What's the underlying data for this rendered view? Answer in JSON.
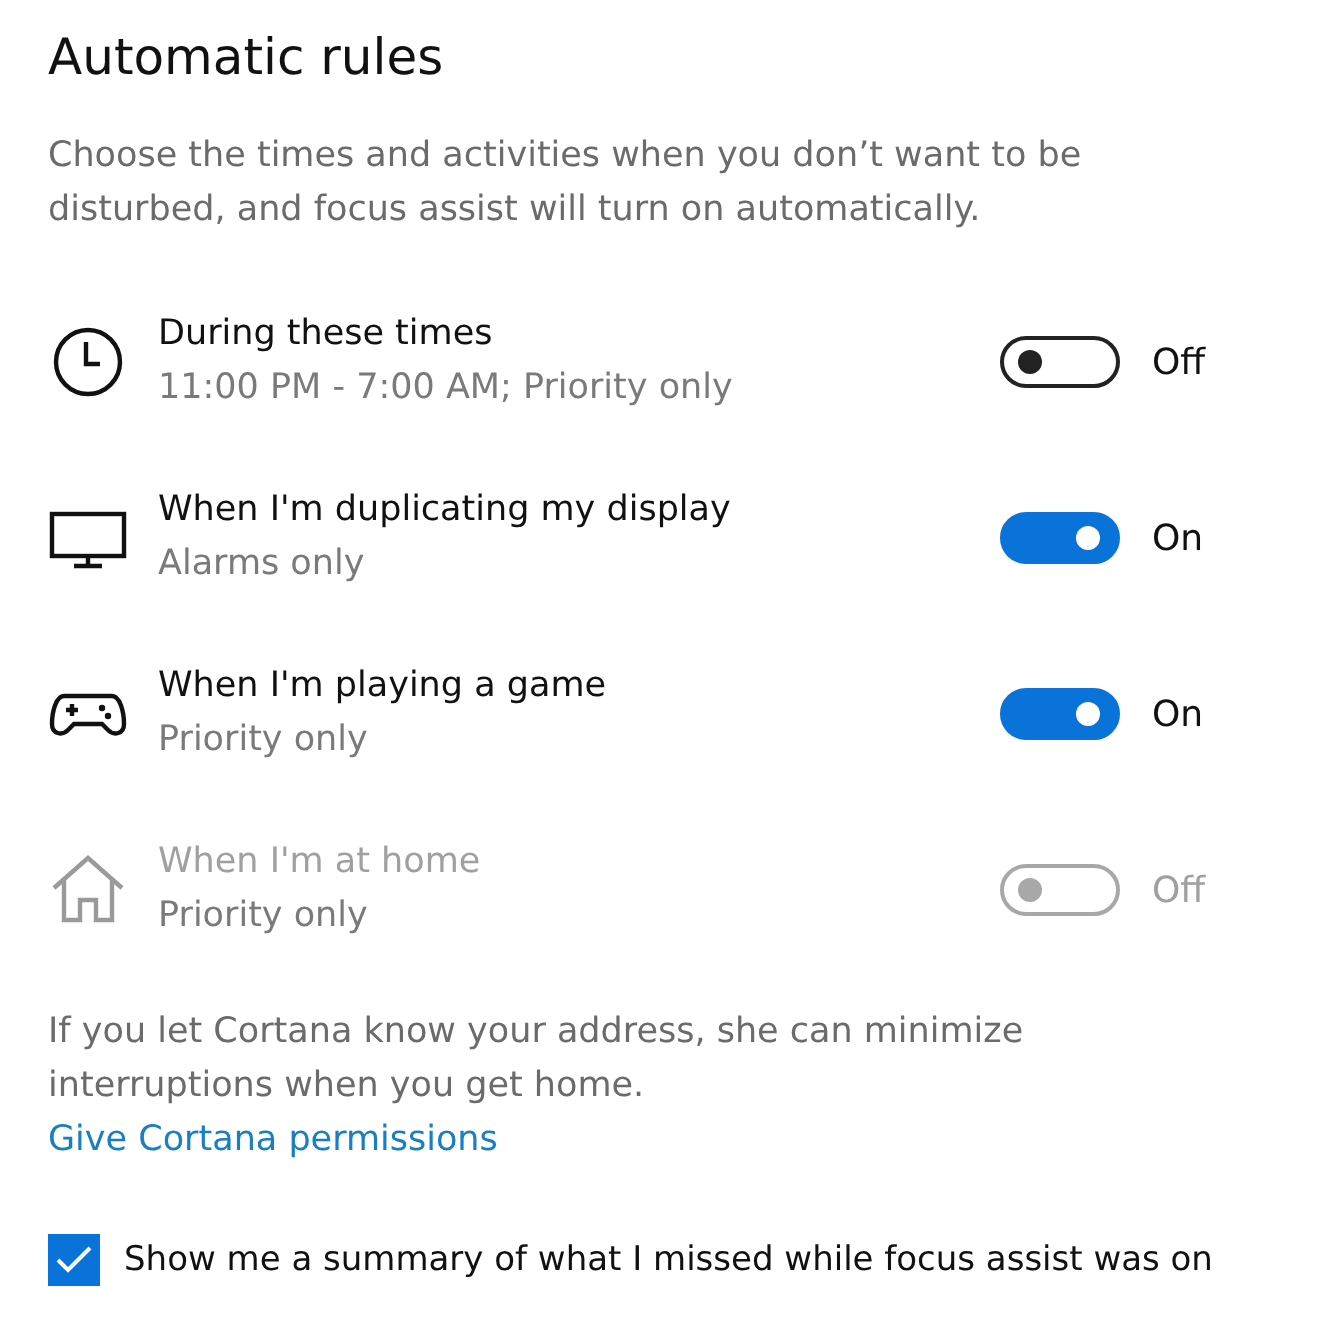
{
  "title": "Automatic rules",
  "description": "Choose the times and activities when you don’t want to be disturbed, and focus assist will turn on automatically.",
  "rules": [
    {
      "kind": "clock",
      "title": "During these times",
      "subtitle": "11:00 PM - 7:00 AM; Priority only",
      "on": false,
      "disabled": false,
      "state_label": "Off"
    },
    {
      "kind": "monitor",
      "title": "When I'm duplicating my display",
      "subtitle": "Alarms only",
      "on": true,
      "disabled": false,
      "state_label": "On"
    },
    {
      "kind": "gamepad",
      "title": "When I'm playing a game",
      "subtitle": "Priority only",
      "on": true,
      "disabled": false,
      "state_label": "On"
    },
    {
      "kind": "house",
      "title": "When I'm at home",
      "subtitle": "Priority only",
      "on": false,
      "disabled": true,
      "state_label": "Off"
    }
  ],
  "cortana_note": "If you let Cortana know your address, she can minimize interruptions when you get home.",
  "cortana_link": "Give Cortana permissions",
  "summary_checkbox": {
    "label": "Show me a summary of what I missed while focus assist was on",
    "checked": true
  }
}
